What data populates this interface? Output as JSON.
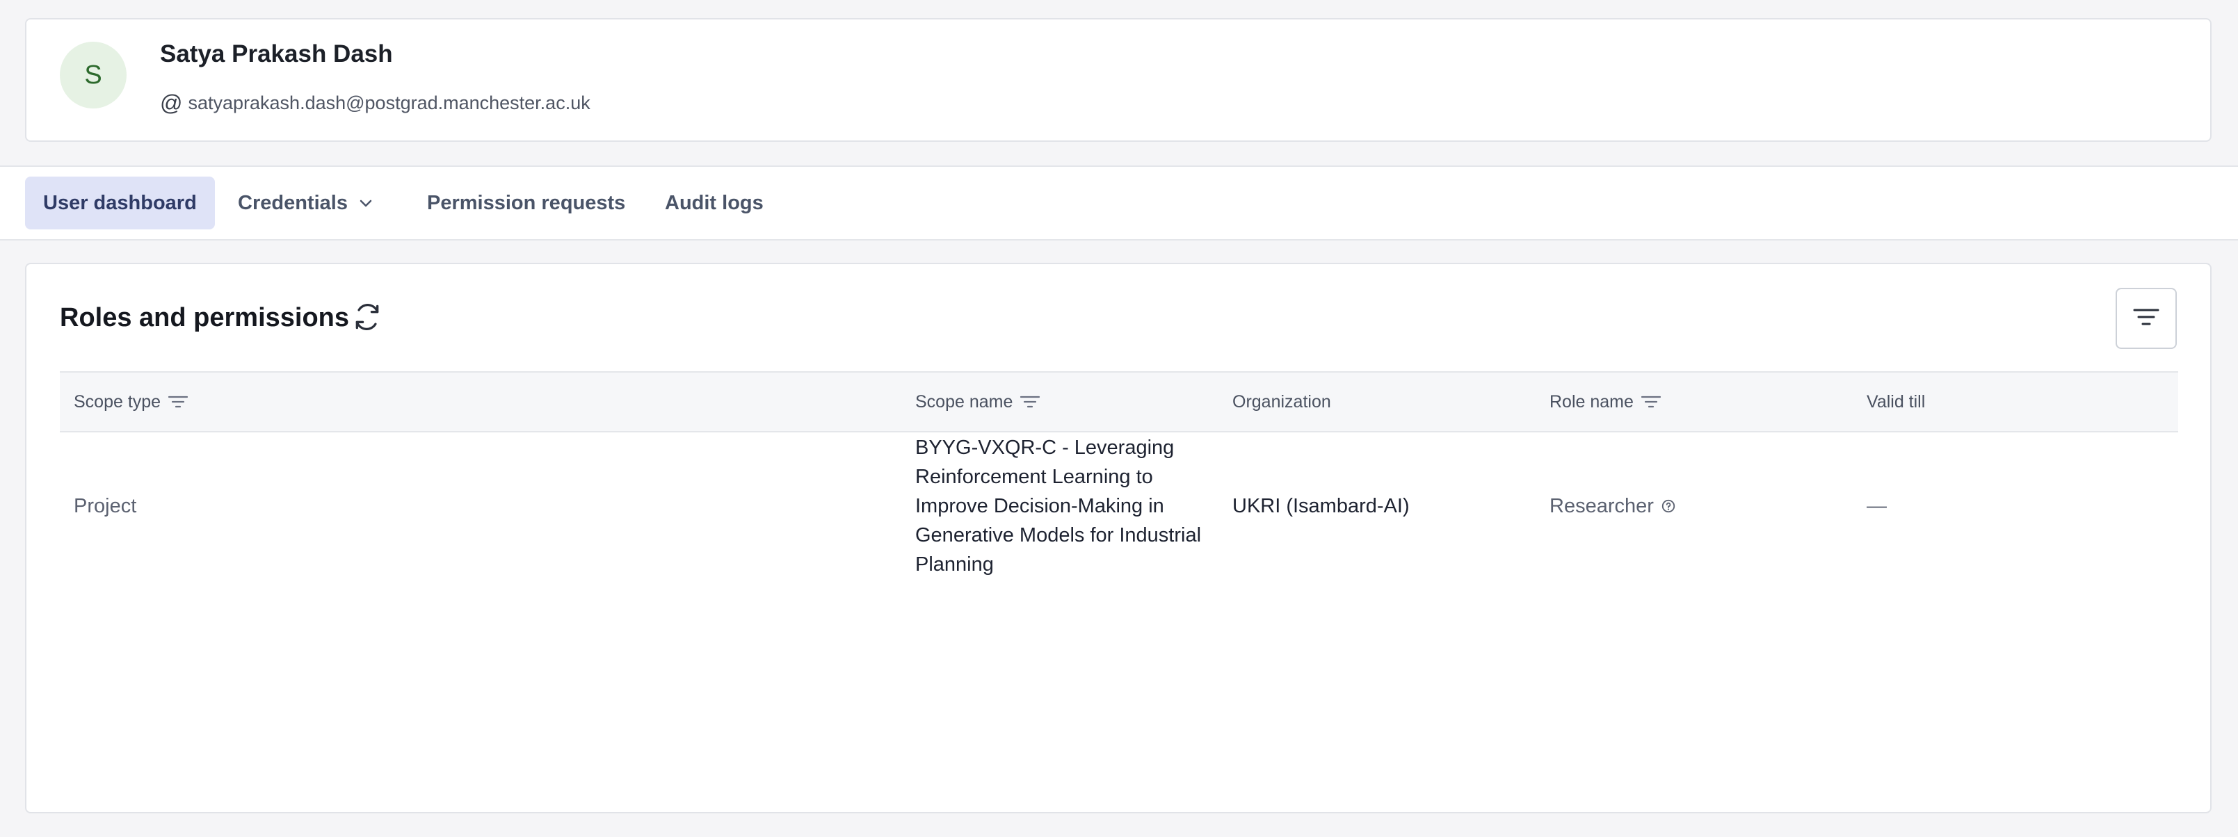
{
  "profile": {
    "avatar_initial": "S",
    "name": "Satya Prakash Dash",
    "email": "satyaprakash.dash@postgrad.manchester.ac.uk"
  },
  "nav": {
    "tabs": [
      {
        "label": "User dashboard",
        "active": true
      },
      {
        "label": "Credentials",
        "has_dropdown": true
      },
      {
        "label": "Permission requests"
      },
      {
        "label": "Audit logs"
      }
    ]
  },
  "roles": {
    "title": "Roles and permissions",
    "columns": [
      "Scope type",
      "Scope name",
      "Organization",
      "Role name",
      "Valid till"
    ],
    "rows": [
      {
        "scope_type": "Project",
        "scope_name": "BYYG-VXQR-C - Leveraging Reinforcement Learning to Improve Decision-Making in Generative Models for Industrial Planning",
        "organization": "UKRI (Isambard-AI)",
        "role_name": "Researcher",
        "valid_till": "—"
      }
    ]
  },
  "icons": {
    "at": "at-sign-icon",
    "refresh": "refresh-icon",
    "filter": "filter-icon",
    "chevron": "chevron-down-icon",
    "help": "help-circle-icon"
  },
  "colors": {
    "active_tab_bg": "#dfe3f7",
    "avatar_bg": "#e6f2e4",
    "avatar_text": "#2c6a2c"
  }
}
